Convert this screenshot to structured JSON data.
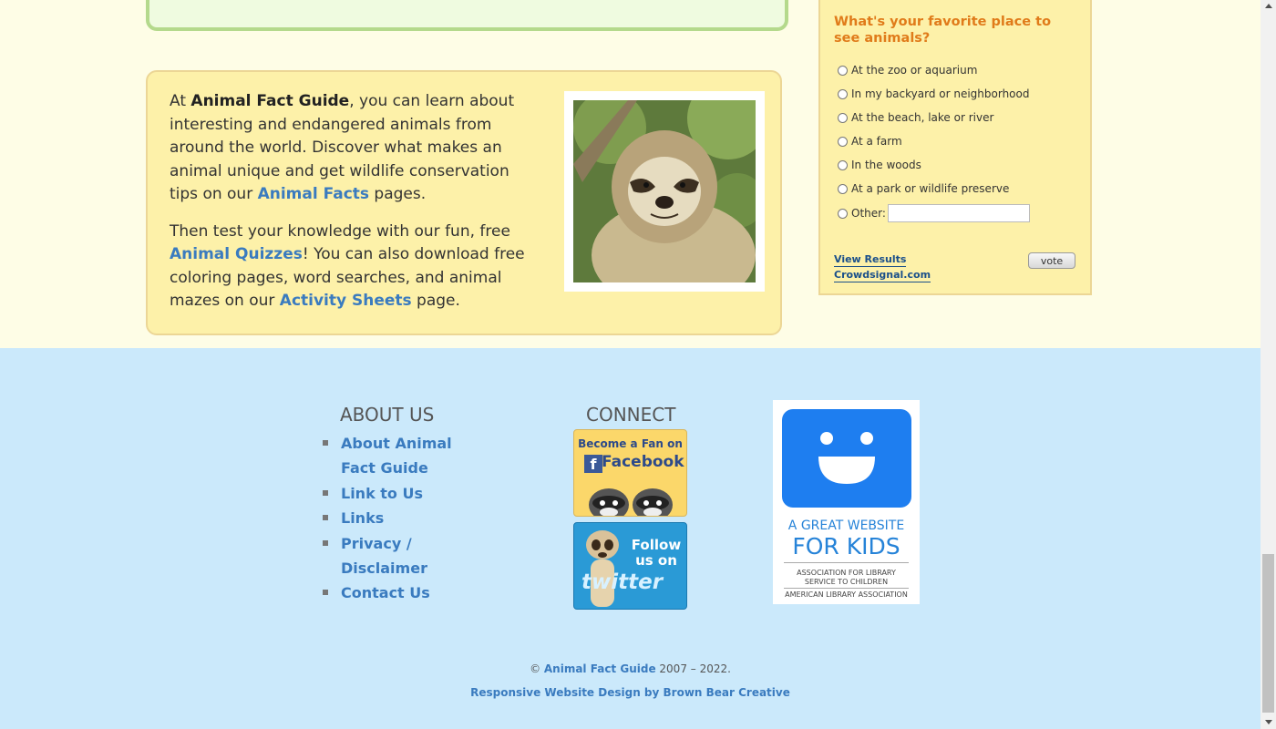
{
  "intro": {
    "p1_prefix": "At ",
    "site_name": "Animal Fact Guide",
    "p1_mid": ", you can learn about interesting and endangered animals from around the world. Discover what makes an animal unique and get wildlife conservation tips on our ",
    "animal_facts_link": "Animal Facts",
    "p1_suffix": " pages.",
    "p2_prefix": "Then test your knowledge with our fun, free ",
    "quizzes_link": "Animal Quizzes",
    "p2_mid": "! You can also download free coloring pages, word searches, and animal mazes on our ",
    "activity_link": "Activity Sheets",
    "p2_suffix": " page."
  },
  "poll": {
    "question": "What's your favorite place to see animals?",
    "options": [
      "At the zoo or aquarium",
      "In my backyard or neighborhood",
      "At the beach, lake or river",
      "At a farm",
      "In the woods",
      "At a park or wildlife preserve",
      "Other:"
    ],
    "view_results": "View Results",
    "crowdsignal": "Crowdsignal.com",
    "vote_label": "vote"
  },
  "footer": {
    "about_title": "ABOUT US",
    "about_links": [
      "About Animal Fact Guide",
      "Link to Us",
      "Links",
      "Privacy / Disclaimer",
      "Contact Us"
    ],
    "connect_title": "CONNECT",
    "facebook_badge": {
      "line1": "Become a Fan on",
      "line2": "Facebook",
      "logo": "f"
    },
    "twitter_badge": {
      "line1": "Follow us on",
      "line2": "twitter"
    },
    "award": {
      "line1": "A GREAT WEBSITE",
      "line2": "FOR KIDS",
      "line3": "ASSOCIATION FOR LIBRARY SERVICE TO CHILDREN",
      "line4": "AMERICAN LIBRARY ASSOCIATION"
    },
    "copyright_prefix": "© ",
    "copyright_link": "Animal Fact Guide",
    "copyright_suffix": " 2007 – 2022.",
    "credit": "Responsive Website Design by Brown Bear Creative"
  }
}
